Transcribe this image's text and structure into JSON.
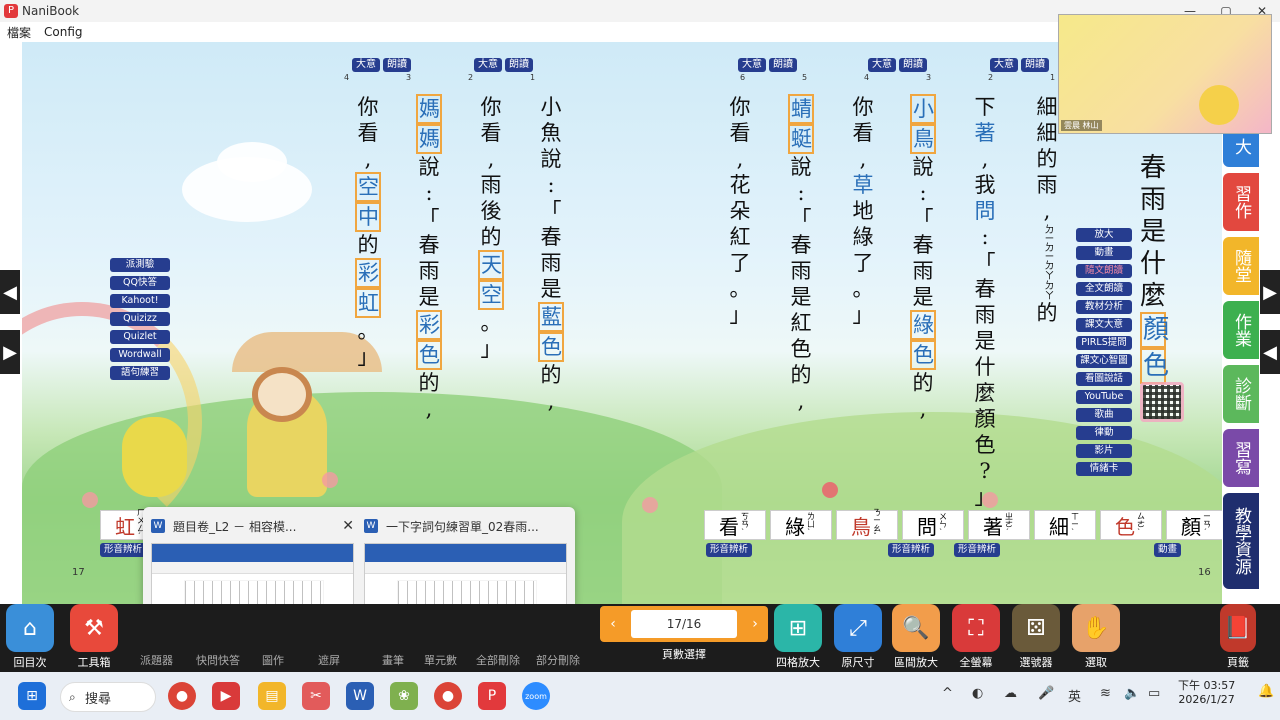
{
  "window": {
    "title": "NaniBook",
    "min": "—",
    "max": "▢",
    "close": "✕"
  },
  "menu": [
    "檔案",
    "Config"
  ],
  "page_numbers": {
    "left": "17",
    "right": "16"
  },
  "top_buttons": {
    "main": "大意",
    "read": "朗讀"
  },
  "para_numbers": [
    "4",
    "3",
    "2",
    "1",
    "6",
    "5",
    "4",
    "3",
    "2",
    "1"
  ],
  "left_buttons": [
    "派測驗",
    "QQ快答",
    "Kahoot!",
    "Quizizz",
    "Quizlet",
    "Wordwall",
    "語句練習"
  ],
  "right_buttons": [
    "放大",
    "動畫",
    "隨文朗讀",
    "全文朗讀",
    "教材分析",
    "課文大意",
    "PIRLS提問",
    "課文心智圖",
    "看圖說話",
    "YouTube",
    "歌曲",
    "律動",
    "影片",
    "情緒卡"
  ],
  "title_chars": [
    "春",
    "雨",
    "是",
    "什",
    "麼",
    "顏",
    "色"
  ],
  "word_cards": [
    {
      "ch": "看",
      "zy": "ㄎㄢˋ"
    },
    {
      "ch": "綠",
      "zy": "ㄌㄩˋ"
    },
    {
      "ch": "鳥",
      "zy": "ㄋㄧㄠˇ"
    },
    {
      "ch": "問",
      "zy": "ㄨㄣˋ"
    },
    {
      "ch": "著",
      "zy": "ㄓㄜˊ"
    },
    {
      "ch": "細",
      "zy": "ㄒㄧˋ"
    },
    {
      "ch": "色",
      "zy": "ㄙㄜˋ"
    },
    {
      "ch": "顏",
      "zy": "ㄧㄢˊ"
    }
  ],
  "left_word_card": {
    "ch": "虹",
    "zy": "ㄏㄨㄥˊ"
  },
  "word_tags": {
    "shape": "形音辨析",
    "anim": "動畫"
  },
  "side_tabs": [
    "大",
    "習作",
    "隨堂",
    "作業",
    "診斷",
    "習寫",
    "教學資源"
  ],
  "webcam": {
    "name": "雲晨 林山"
  },
  "thumbnails": [
    {
      "title": "題目卷_L2 － 相容模...",
      "close": "✕"
    },
    {
      "title": "一下字詞句練習單_02春雨..."
    }
  ],
  "bottom_buttons": [
    {
      "label": "回目次"
    },
    {
      "label": "工具箱"
    },
    {
      "label": "四格放大"
    },
    {
      "label": "原尺寸"
    },
    {
      "label": "區間放大"
    },
    {
      "label": "全螢幕"
    },
    {
      "label": "選號器"
    },
    {
      "label": "選取"
    },
    {
      "label": "頁籤"
    }
  ],
  "hidden_labels": [
    "派題器",
    "快問快答",
    "圖作",
    "遮屏",
    "畫筆",
    "單元數",
    "全部刪除",
    "部分刪除"
  ],
  "page_selector": {
    "value": "17/16",
    "label": "頁數選擇",
    "prev": "‹",
    "next": "›"
  },
  "taskbar": {
    "search": "搜尋",
    "ime": "英",
    "time": "下午 03:57",
    "date": "2026/1/27",
    "chevron": "^"
  },
  "lines": [
    {
      "chars": [
        "你",
        "看",
        ",",
        "空",
        "中",
        "的",
        "彩",
        "虹",
        "。",
        "」"
      ]
    },
    {
      "chars": [
        "媽",
        "媽",
        "說",
        ":",
        "「",
        "春",
        "雨",
        "是",
        "彩",
        "色",
        "的",
        ","
      ]
    },
    {
      "chars": [
        "你",
        "看",
        ",",
        "雨",
        "後",
        "的",
        "天",
        "空",
        "。",
        "」"
      ]
    },
    {
      "chars": [
        "小",
        "魚",
        "說",
        ":",
        "「",
        "春",
        "雨",
        "是",
        "藍",
        "色",
        "的",
        ","
      ]
    },
    {
      "chars": [
        "你",
        "看",
        ",",
        "花",
        "朵",
        "紅",
        "了",
        "。",
        "」"
      ]
    },
    {
      "chars": [
        "蜻",
        "蜓",
        "說",
        ":",
        "「",
        "春",
        "雨",
        "是",
        "紅",
        "色",
        "的",
        ","
      ]
    },
    {
      "chars": [
        "你",
        "看",
        ",",
        "草",
        "地",
        "綠",
        "了",
        "。",
        "」"
      ]
    },
    {
      "chars": [
        "小",
        "鳥",
        "說",
        ":",
        "「",
        "春",
        "雨",
        "是",
        "綠",
        "色",
        "的",
        ","
      ]
    },
    {
      "chars": [
        "下",
        "著",
        ",",
        "我",
        "問",
        ":",
        "「",
        "春",
        "雨",
        "是",
        "什",
        "麼",
        "顏",
        "色",
        "?",
        "」"
      ]
    },
    {
      "chars": [
        "細",
        "細",
        "的",
        "雨",
        ",",
        "ㄉㄧ",
        "ㄉㄧ",
        "ㄉㄚ",
        "ㄉㄚ",
        "的"
      ]
    }
  ]
}
